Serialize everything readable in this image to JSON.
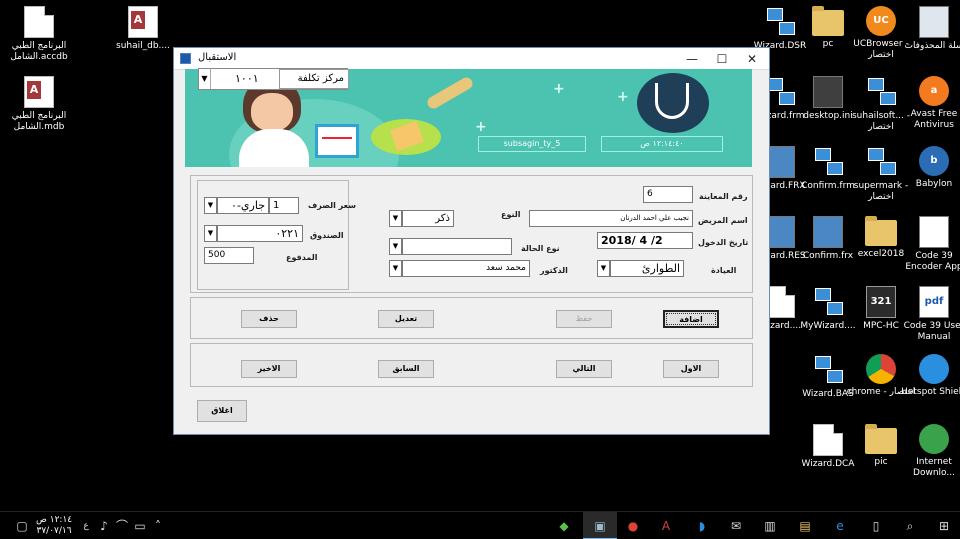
{
  "desktop_left": [
    {
      "name": "البرنامج الطبي الشامل.accdb",
      "icon": "access-file-icon"
    },
    {
      "name": "suhail_db....",
      "icon": "access-file-icon"
    },
    {
      "name": "البرنامج الطبي الشامل.mdb",
      "icon": "access-file-icon"
    }
  ],
  "desktop_right": [
    {
      "name": "Wizard.DSR"
    },
    {
      "name": "pc"
    },
    {
      "name": "UCBrowser - اختصار"
    },
    {
      "name": "سلة المحذوفات"
    },
    {
      "name": "Wizard.frm"
    },
    {
      "name": "desktop.ini"
    },
    {
      "name": "suhailsoft... - اختصار"
    },
    {
      "name": "Avast Free Antivirus"
    },
    {
      "name": "Wizard.FRX"
    },
    {
      "name": "Confirm.frm"
    },
    {
      "name": "supermark - اختصار"
    },
    {
      "name": "Babylon"
    },
    {
      "name": "Wizard.RES"
    },
    {
      "name": "Confirm.frx"
    },
    {
      "name": "excel2018"
    },
    {
      "name": "Code 39 Encoder App"
    },
    {
      "name": "Wizard...."
    },
    {
      "name": "MyWizard...."
    },
    {
      "name": "MPC-HC"
    },
    {
      "name": "Code 39 User Manual"
    },
    {
      "name": "Wizard.BAS"
    },
    {
      "name": "chrome - اختصار"
    },
    {
      "name": "Hotspot Shield"
    },
    {
      "name": "Wizard.DCA"
    },
    {
      "name": "pic"
    },
    {
      "name": "Internet Downlo..."
    }
  ],
  "window": {
    "title": "الاستقبال",
    "minimize": "—",
    "maximize": "☐",
    "close": "✕"
  },
  "banner": {
    "cost_center_label": "مركز تكلفة",
    "cost_center_value": "١٠٠١",
    "user_box": "subsagin_ty_5",
    "time_box": "١٢:١٤:٤٠ ص"
  },
  "form": {
    "visit_no_label": "رقم المعاينة",
    "visit_no_value": "6",
    "patient_label": "اسم المريض",
    "patient_value": "نجيب علي احمد الدرنان",
    "type_label": "النوع",
    "type_value": "ذكر",
    "entry_date_label": "تاريخ الدخول",
    "entry_date_value": "2018/ 4 /2",
    "case_type_label": "نوع الحالة",
    "case_type_value": "",
    "clinic_label": "العيادة",
    "clinic_value": "الطوارئ",
    "doctor_label": "الدكتور",
    "doctor_value": "محمد سعد",
    "exchange_label": "سعر الصرف",
    "exchange_value": "1",
    "currency_value": "جاري-٠",
    "fund_label": "الصندوق",
    "fund_value": "٠٢٢١",
    "paid_label": "المدفوع",
    "paid_value": "500"
  },
  "actions": {
    "add": "اضافة",
    "save": "حفظ",
    "edit": "تعديل",
    "delete": "حذف"
  },
  "navigation": {
    "first": "الاول",
    "next": "التالي",
    "previous": "السابق",
    "last": "الاخير"
  },
  "close_button": "اغلاق",
  "taskbar": {
    "time": "١٢:١٤ ص",
    "date": "٣٧/٠٧/١٦",
    "lang": "ع"
  }
}
